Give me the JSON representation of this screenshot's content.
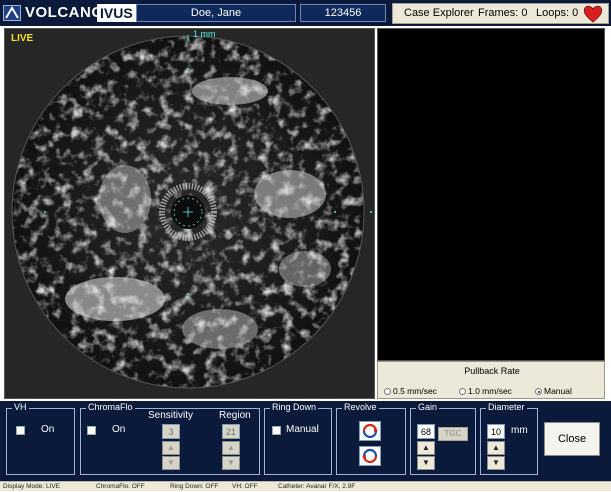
{
  "header": {
    "logo_text": "VOLCANO",
    "logo_badge": "IVUS",
    "patient_name": "Doe, Jane",
    "patient_id": "123456",
    "case_explorer": "Case Explorer",
    "frames": "Frames: 0",
    "loops": "Loops: 0"
  },
  "image": {
    "live_label": "LIVE",
    "scale_label": "1 mm"
  },
  "pullback": {
    "title": "Pullback Rate",
    "options": [
      "0.5 mm/sec",
      "1.0 mm/sec",
      "Manual"
    ],
    "selected": "Manual"
  },
  "controls": {
    "vh": {
      "title": "VH",
      "checkbox_label": "On"
    },
    "chromaflo": {
      "title": "ChromaFlo",
      "checkbox_label": "On",
      "sensitivity_label": "Sensitivity",
      "sensitivity_value": "3",
      "region_label": "Region",
      "region_value": "21"
    },
    "ringdown": {
      "title": "Ring Down",
      "checkbox_label": "Manual"
    },
    "revolve": {
      "title": "Revolve"
    },
    "gain": {
      "title": "Gain",
      "value": "68",
      "tgc_label": "TGC"
    },
    "diameter": {
      "title": "Diameter",
      "value": "10",
      "unit": "mm"
    },
    "close_label": "Close"
  },
  "status_bar": {
    "display_mode": "Display Mode: LIVE",
    "chromaflo": "ChromaFlo: OFF",
    "ring_down": "Ring Down: OFF",
    "vh": "VH: OFF",
    "catheter": "Catheter: Avanar F/X, 2.9F"
  },
  "colors": {
    "header_bg": "#0b1a3a",
    "live_label": "#f3e12a",
    "scale_label": "#4ff0e4",
    "heart": "#d8201e"
  }
}
